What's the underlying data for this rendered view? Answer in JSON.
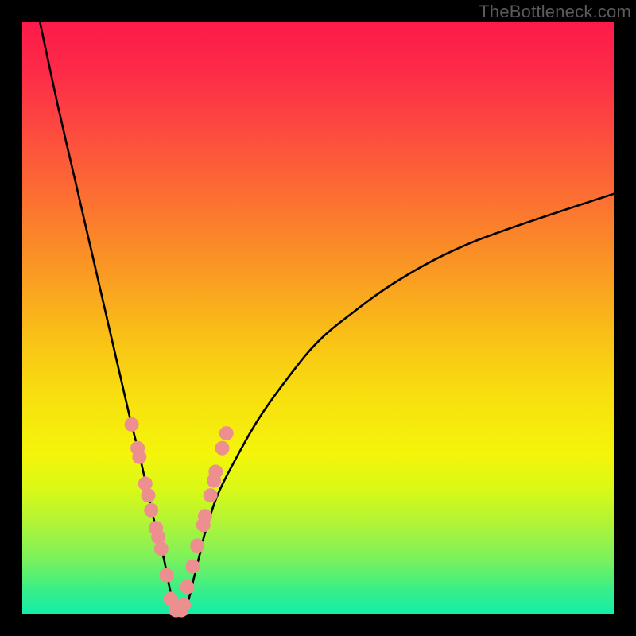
{
  "watermark": "TheBottleneck.com",
  "colors": {
    "frame": "#000000",
    "curve": "#000000",
    "marker_fill": "#ed8f8f",
    "marker_stroke": "#e98383",
    "gradient_stops": [
      "#fd1a4a",
      "#fd2a48",
      "#fd4640",
      "#fc6a34",
      "#fa9225",
      "#f9c017",
      "#f8df0f",
      "#f4f50a",
      "#d9f917",
      "#aef438",
      "#78f15e",
      "#39ee88",
      "#13eea8"
    ]
  },
  "chart_data": {
    "type": "line",
    "title": "",
    "xlabel": "",
    "ylabel": "",
    "xlim": [
      0,
      100
    ],
    "ylim": [
      0,
      100
    ],
    "grid": false,
    "legend": false,
    "description": "Bottleneck-style curve: a sharp V with minimum near x≈26, left branch reaching 100% at x≈3, right branch climbing asymptotically toward ~71% by x=100. No axis ticks or numeric labels are shown in the image; curve values below are read off the shape.",
    "series": [
      {
        "name": "bottleneck-curve",
        "x": [
          3,
          6,
          9,
          12,
          15,
          18,
          20,
          22,
          23,
          24,
          25,
          26,
          27,
          28,
          29,
          30,
          31,
          33,
          36,
          40,
          45,
          50,
          56,
          63,
          72,
          82,
          100
        ],
        "y": [
          100,
          86,
          73,
          60,
          47,
          34,
          26,
          17,
          13,
          9,
          4,
          0.5,
          0.5,
          2,
          6,
          10,
          14,
          20,
          26,
          33,
          40,
          46,
          51,
          56,
          61,
          65,
          71
        ]
      }
    ],
    "markers": {
      "description": "Salmon dots along the lower portion of the curve (near the valley).",
      "x": [
        18.5,
        19.5,
        19.8,
        20.8,
        21.3,
        21.8,
        22.6,
        23.0,
        23.5,
        24.4,
        25.1,
        26.0,
        26.9,
        27.3,
        27.9,
        28.8,
        29.6,
        30.6,
        30.9,
        31.8,
        32.4,
        32.7,
        33.8,
        34.5
      ],
      "y": [
        32.0,
        28.0,
        26.5,
        22.0,
        20.0,
        17.5,
        14.5,
        13.0,
        11.0,
        6.5,
        2.5,
        0.6,
        0.6,
        1.5,
        4.5,
        8.0,
        11.5,
        15.0,
        16.5,
        20.0,
        22.5,
        24.0,
        28.0,
        30.5
      ]
    }
  }
}
